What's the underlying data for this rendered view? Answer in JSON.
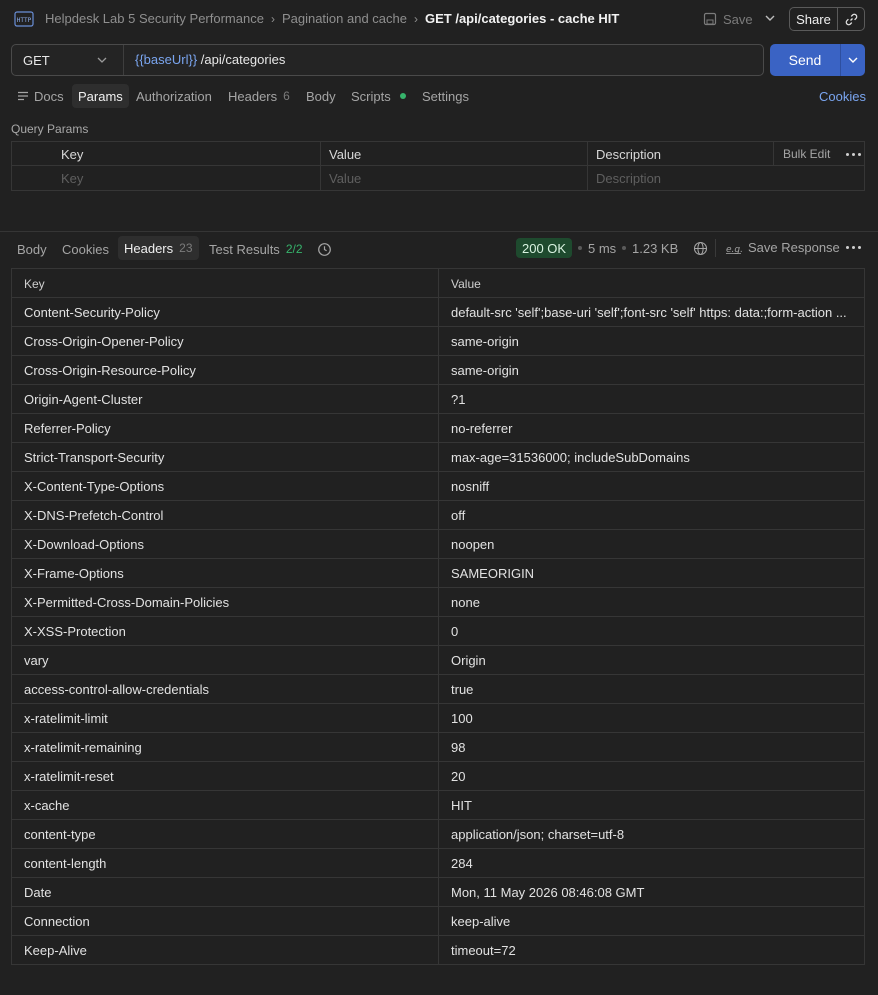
{
  "breadcrumb": {
    "collection": "Helpdesk Lab 5 Security Performance",
    "folder": "Pagination and cache",
    "request": "GET /api/categories - cache HIT"
  },
  "toolbar": {
    "save_label": "Save",
    "share_label": "Share"
  },
  "request": {
    "method": "GET",
    "url_variable": "{{baseUrl}}",
    "url_path": " /api/categories",
    "send_label": "Send"
  },
  "request_tabs": {
    "docs": "Docs",
    "params": "Params",
    "authorization": "Authorization",
    "headers": "Headers",
    "headers_count": "6",
    "body": "Body",
    "scripts": "Scripts",
    "settings": "Settings",
    "cookies": "Cookies"
  },
  "query_params": {
    "title": "Query Params",
    "columns": {
      "key": "Key",
      "value": "Value",
      "description": "Description"
    },
    "bulk_edit": "Bulk Edit",
    "placeholders": {
      "key": "Key",
      "value": "Value",
      "description": "Description"
    }
  },
  "response_tabs": {
    "body": "Body",
    "cookies": "Cookies",
    "headers": "Headers",
    "headers_count": "23",
    "test_results": "Test Results",
    "test_results_count": "2/2"
  },
  "response_meta": {
    "status": "200 OK",
    "time": "5 ms",
    "size": "1.23 KB",
    "save_response": "Save Response"
  },
  "headers_table": {
    "columns": {
      "key": "Key",
      "value": "Value"
    },
    "rows": [
      {
        "key": "Content-Security-Policy",
        "value": "default-src 'self';base-uri 'self';font-src 'self' https: data:;form-action ..."
      },
      {
        "key": "Cross-Origin-Opener-Policy",
        "value": "same-origin"
      },
      {
        "key": "Cross-Origin-Resource-Policy",
        "value": "same-origin"
      },
      {
        "key": "Origin-Agent-Cluster",
        "value": "?1"
      },
      {
        "key": "Referrer-Policy",
        "value": "no-referrer"
      },
      {
        "key": "Strict-Transport-Security",
        "value": "max-age=31536000; includeSubDomains"
      },
      {
        "key": "X-Content-Type-Options",
        "value": "nosniff"
      },
      {
        "key": "X-DNS-Prefetch-Control",
        "value": "off"
      },
      {
        "key": "X-Download-Options",
        "value": "noopen"
      },
      {
        "key": "X-Frame-Options",
        "value": "SAMEORIGIN"
      },
      {
        "key": "X-Permitted-Cross-Domain-Policies",
        "value": "none"
      },
      {
        "key": "X-XSS-Protection",
        "value": "0"
      },
      {
        "key": "vary",
        "value": "Origin"
      },
      {
        "key": "access-control-allow-credentials",
        "value": "true"
      },
      {
        "key": "x-ratelimit-limit",
        "value": "100"
      },
      {
        "key": "x-ratelimit-remaining",
        "value": "98"
      },
      {
        "key": "x-ratelimit-reset",
        "value": "20"
      },
      {
        "key": "x-cache",
        "value": "HIT"
      },
      {
        "key": "content-type",
        "value": "application/json; charset=utf-8"
      },
      {
        "key": "content-length",
        "value": "284"
      },
      {
        "key": "Date",
        "value": "Mon, 11 May 2026 08:46:08 GMT"
      },
      {
        "key": "Connection",
        "value": "keep-alive"
      },
      {
        "key": "Keep-Alive",
        "value": "timeout=72"
      }
    ]
  },
  "colors": {
    "background": "#212121",
    "accent": "#3a63c4",
    "link": "#7aa5ef",
    "status_ok_bg": "#1e4a2e",
    "scripts_dot": "#36b36b"
  },
  "icons": {
    "app": "http-icon",
    "save": "save-icon",
    "share": "link-icon",
    "docs": "docs-icon",
    "history": "history-icon",
    "globe": "globe-icon",
    "example": "example-icon",
    "more": "more-icon"
  }
}
